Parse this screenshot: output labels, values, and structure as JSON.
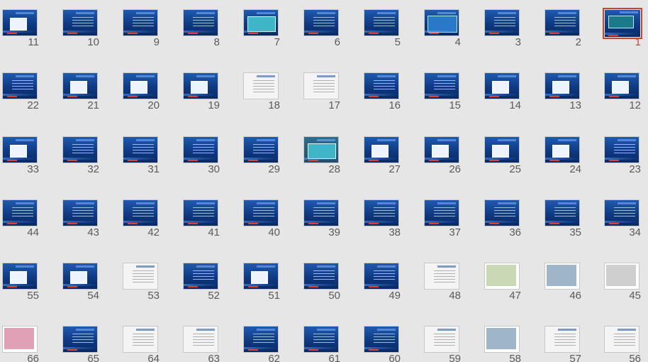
{
  "app": "Slide Sorter",
  "selected_slide": 1,
  "colors": {
    "selection": "#c8472a",
    "background": "#e6e6e6",
    "slide_blue": "#0f3a82"
  },
  "slides": [
    {
      "n": "1",
      "v": "title"
    },
    {
      "n": "2",
      "v": "text"
    },
    {
      "n": "3",
      "v": "text"
    },
    {
      "n": "4",
      "v": "diagram"
    },
    {
      "n": "5",
      "v": "text"
    },
    {
      "n": "6",
      "v": "text"
    },
    {
      "n": "7",
      "v": "grid"
    },
    {
      "n": "8",
      "v": "text"
    },
    {
      "n": "9",
      "v": "text"
    },
    {
      "n": "10",
      "v": "text"
    },
    {
      "n": "11",
      "v": "pic"
    },
    {
      "n": "12",
      "v": "pic"
    },
    {
      "n": "13",
      "v": "pic"
    },
    {
      "n": "14",
      "v": "pic"
    },
    {
      "n": "15",
      "v": "table"
    },
    {
      "n": "16",
      "v": "text"
    },
    {
      "n": "17",
      "v": "white"
    },
    {
      "n": "18",
      "v": "white"
    },
    {
      "n": "19",
      "v": "pic"
    },
    {
      "n": "20",
      "v": "pic"
    },
    {
      "n": "21",
      "v": "pic"
    },
    {
      "n": "22",
      "v": "table"
    },
    {
      "n": "23",
      "v": "text"
    },
    {
      "n": "24",
      "v": "pic"
    },
    {
      "n": "25",
      "v": "pic"
    },
    {
      "n": "26",
      "v": "pic"
    },
    {
      "n": "27",
      "v": "pic"
    },
    {
      "n": "28",
      "v": "teal"
    },
    {
      "n": "29",
      "v": "text"
    },
    {
      "n": "30",
      "v": "text"
    },
    {
      "n": "31",
      "v": "text"
    },
    {
      "n": "32",
      "v": "text"
    },
    {
      "n": "33",
      "v": "pic"
    },
    {
      "n": "34",
      "v": "text"
    },
    {
      "n": "35",
      "v": "text"
    },
    {
      "n": "36",
      "v": "text"
    },
    {
      "n": "37",
      "v": "text"
    },
    {
      "n": "38",
      "v": "text"
    },
    {
      "n": "39",
      "v": "text"
    },
    {
      "n": "40",
      "v": "text"
    },
    {
      "n": "41",
      "v": "text"
    },
    {
      "n": "42",
      "v": "text"
    },
    {
      "n": "43",
      "v": "text"
    },
    {
      "n": "44",
      "v": "text"
    },
    {
      "n": "45",
      "v": "photo"
    },
    {
      "n": "46",
      "v": "photo"
    },
    {
      "n": "47",
      "v": "photo"
    },
    {
      "n": "48",
      "v": "white"
    },
    {
      "n": "49",
      "v": "text"
    },
    {
      "n": "50",
      "v": "table"
    },
    {
      "n": "51",
      "v": "pic"
    },
    {
      "n": "52",
      "v": "text"
    },
    {
      "n": "53",
      "v": "white"
    },
    {
      "n": "54",
      "v": "pic"
    },
    {
      "n": "55",
      "v": "pic"
    },
    {
      "n": "56",
      "v": "white"
    },
    {
      "n": "57",
      "v": "white"
    },
    {
      "n": "58",
      "v": "photo"
    },
    {
      "n": "59",
      "v": "white"
    },
    {
      "n": "60",
      "v": "text"
    },
    {
      "n": "61",
      "v": "text"
    },
    {
      "n": "62",
      "v": "text"
    },
    {
      "n": "63",
      "v": "white"
    },
    {
      "n": "64",
      "v": "white"
    },
    {
      "n": "65",
      "v": "text"
    },
    {
      "n": "66",
      "v": "photo"
    }
  ]
}
